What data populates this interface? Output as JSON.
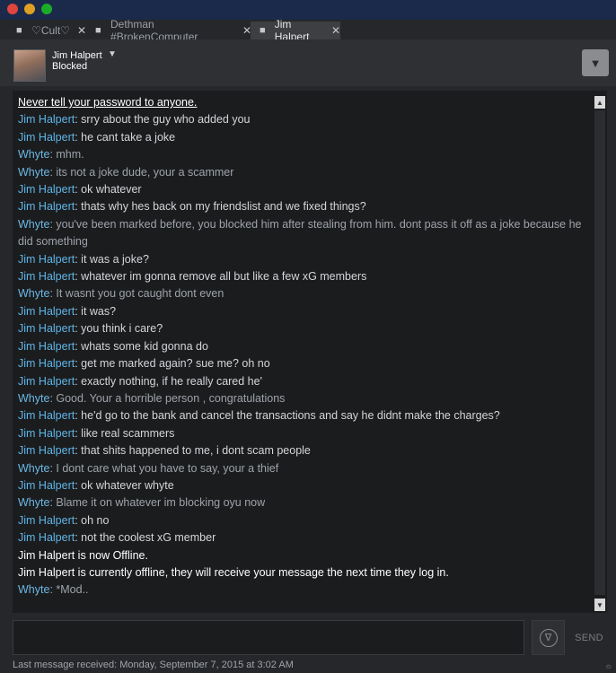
{
  "tabs": [
    {
      "label": "♡Cult♡",
      "active": false
    },
    {
      "label": "Dethman #BrokenComputer",
      "active": false
    },
    {
      "label": "Jim Halpert",
      "active": true
    }
  ],
  "icons": {
    "tab": "chat-bubble-icon",
    "close": "close-icon",
    "caret": "caret-down-icon",
    "menu": "triangle-down-icon",
    "emoji": "smiley-icon"
  },
  "header": {
    "name": "Jim Halpert",
    "status": "Blocked"
  },
  "colors": {
    "jim": "#5eb6e8",
    "whyte": "#6bb8e6",
    "background": "#1b1c1e"
  },
  "messages": [
    {
      "type": "notice",
      "text": "Never tell your password to anyone."
    },
    {
      "type": "jim",
      "sender": "Jim Halpert",
      "text": ": srry about the guy who added you"
    },
    {
      "type": "jim",
      "sender": "Jim Halpert",
      "text": ": he cant take a joke"
    },
    {
      "type": "whyte",
      "sender": "Whyte",
      "text": ": mhm."
    },
    {
      "type": "whyte",
      "sender": "Whyte",
      "text": ": its not a joke dude, your a scammer"
    },
    {
      "type": "jim",
      "sender": "Jim Halpert",
      "text": ": ok whatever"
    },
    {
      "type": "jim",
      "sender": "Jim Halpert",
      "text": ": thats why hes back on my friendslist and we fixed things?"
    },
    {
      "type": "whyte",
      "sender": "Whyte",
      "text": ": you've been marked before, you blocked him after stealing from him. dont pass it off as a joke because he did something"
    },
    {
      "type": "jim",
      "sender": "Jim Halpert",
      "text": ": it was a joke?"
    },
    {
      "type": "jim",
      "sender": "Jim Halpert",
      "text": ": whatever im gonna remove all but like a few xG members"
    },
    {
      "type": "whyte",
      "sender": "Whyte",
      "text": ": It wasnt you got caught dont even"
    },
    {
      "type": "jim",
      "sender": "Jim Halpert",
      "text": ": it was?"
    },
    {
      "type": "jim",
      "sender": "Jim Halpert",
      "text": ": you think i care?"
    },
    {
      "type": "jim",
      "sender": "Jim Halpert",
      "text": ": whats some kid gonna do"
    },
    {
      "type": "jim",
      "sender": "Jim Halpert",
      "text": ": get me marked again? sue me? oh no"
    },
    {
      "type": "jim",
      "sender": "Jim Halpert",
      "text": ": exactly nothing, if he really cared he'"
    },
    {
      "type": "whyte",
      "sender": "Whyte",
      "text": ": Good. Your a horrible person , congratulations"
    },
    {
      "type": "jim",
      "sender": "Jim Halpert",
      "text": ": he'd go to the bank and cancel the transactions and say he didnt make the charges?"
    },
    {
      "type": "jim",
      "sender": "Jim Halpert",
      "text": ": like real scammers"
    },
    {
      "type": "jim",
      "sender": "Jim Halpert",
      "text": ": that shits happened to me, i dont scam people"
    },
    {
      "type": "whyte",
      "sender": "Whyte",
      "text": ": I dont care what you have to say, your a thief"
    },
    {
      "type": "jim",
      "sender": "Jim Halpert",
      "text": ": ok whatever whyte"
    },
    {
      "type": "whyte",
      "sender": "Whyte",
      "text": ": Blame it on whatever im blocking oyu now"
    },
    {
      "type": "jim",
      "sender": "Jim Halpert",
      "text": ": oh no"
    },
    {
      "type": "jim",
      "sender": "Jim Halpert",
      "text": ": not the coolest xG member"
    },
    {
      "type": "system",
      "text": "Jim Halpert is now Offline."
    },
    {
      "type": "system",
      "text": "Jim Halpert is currently offline, they will receive your message the next time they log in."
    },
    {
      "type": "whyte",
      "sender": "Whyte",
      "text": ": *Mod.."
    }
  ],
  "input": {
    "value": "",
    "send_label": "SEND"
  },
  "footer": {
    "text": "Last message received: Monday, September 7, 2015 at 3:02 AM"
  }
}
